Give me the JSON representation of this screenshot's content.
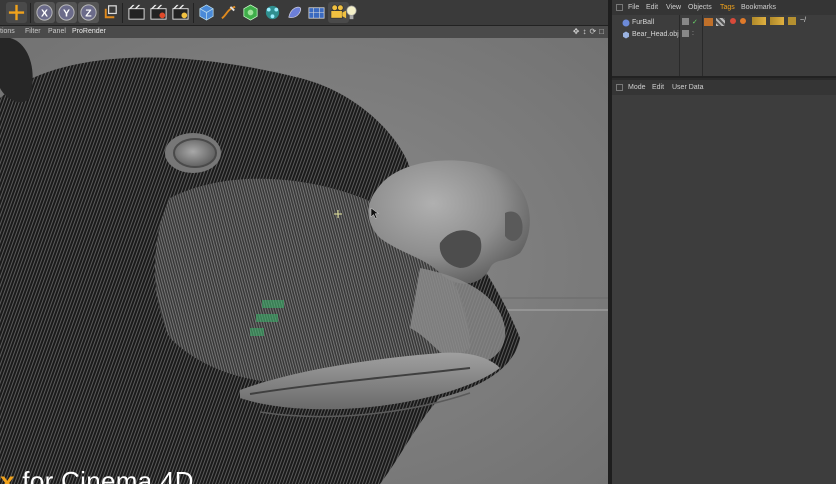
{
  "toolbar": {
    "buttons": [
      {
        "name": "move-icon"
      },
      {
        "name": "x-axis-lock-icon",
        "label": "X"
      },
      {
        "name": "y-axis-lock-icon",
        "label": "Y"
      },
      {
        "name": "z-axis-lock-icon",
        "label": "Z"
      },
      {
        "name": "coordinate-system-icon"
      },
      {
        "name": "render-view-icon"
      },
      {
        "name": "render-picture-viewer-icon"
      },
      {
        "name": "render-settings-icon"
      },
      {
        "name": "cube-primitive-icon"
      },
      {
        "name": "pen-spline-icon"
      },
      {
        "name": "subdivision-generator-icon"
      },
      {
        "name": "cloner-mograph-icon"
      },
      {
        "name": "deformer-icon"
      },
      {
        "name": "floor-environment-icon"
      },
      {
        "name": "camera-icon"
      },
      {
        "name": "light-icon"
      }
    ]
  },
  "viewport": {
    "menu": [
      "tions",
      "Filter",
      "Panel",
      "ProRender"
    ],
    "nav_icons": [
      "move-view-icon",
      "zoom-view-icon",
      "rotate-view-icon",
      "maximize-view-icon"
    ]
  },
  "caption": {
    "accent": "x",
    "text": " for Cinema 4D"
  },
  "object_manager": {
    "menu": [
      "File",
      "Edit",
      "View",
      "Objects",
      "Tags",
      "Bookmarks"
    ],
    "objects": [
      {
        "name": "FurBall"
      },
      {
        "name": "Bear_Head.obj"
      }
    ]
  },
  "attribute_manager": {
    "menu": [
      "Mode",
      "Edit",
      "User Data"
    ]
  },
  "colors": {
    "accent": "#f0a21c",
    "viewport_bg": "#7c7c7c",
    "panel_bg": "#3d3d3d"
  }
}
